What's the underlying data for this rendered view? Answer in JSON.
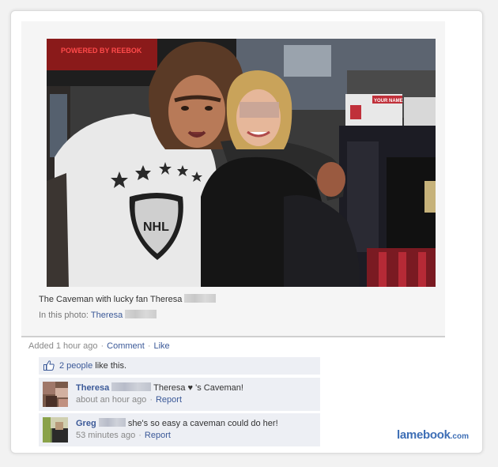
{
  "photo": {
    "banner_text": "POWERED BY REEBOK",
    "sign_text": "YOUR NAME",
    "shirt_logo": "NHL"
  },
  "caption": {
    "text": "The Caveman with lucky fan Theresa"
  },
  "in_photo": {
    "label": "In this photo:",
    "name": "Theresa"
  },
  "meta": {
    "added": "Added 1 hour ago",
    "comment_label": "Comment",
    "like_label": "Like"
  },
  "likes": {
    "count_link": "2 people",
    "suffix": "like this."
  },
  "comments": [
    {
      "name": "Theresa",
      "text": "Theresa ♥ 's Caveman!",
      "time": "about an hour ago",
      "report": "Report"
    },
    {
      "name": "Greg",
      "text": "she's so easy a caveman could do her!",
      "time": "53 minutes ago",
      "report": "Report"
    }
  ],
  "brand": {
    "main": "lamebook",
    "tld": ".com"
  },
  "colors": {
    "link": "#3b5998",
    "comment_bg": "#edeff4",
    "brand": "#3d6eb5"
  }
}
